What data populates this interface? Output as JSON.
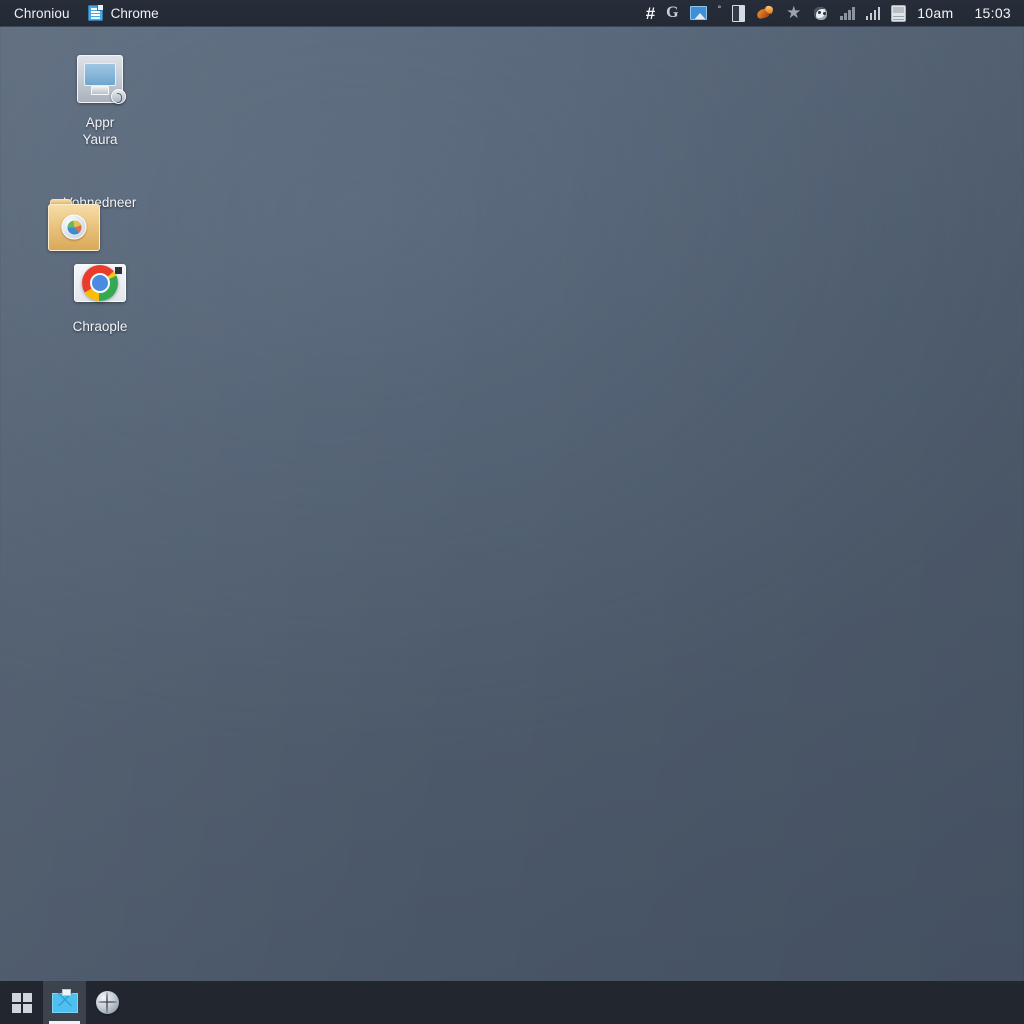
{
  "topbar": {
    "window_title": "Chroniou",
    "tab": {
      "label": "Chrome",
      "icon": "document-icon"
    },
    "tray": {
      "icons": [
        {
          "name": "hash-icon",
          "glyph": "#"
        },
        {
          "name": "google-g-icon",
          "glyph": "G"
        },
        {
          "name": "photo-icon",
          "glyph": ""
        },
        {
          "name": "degree-icon",
          "glyph": "°"
        },
        {
          "name": "book-icon",
          "glyph": ""
        },
        {
          "name": "bird-icon",
          "glyph": ""
        },
        {
          "name": "star-icon",
          "glyph": "★"
        },
        {
          "name": "blob-face-icon",
          "glyph": ""
        },
        {
          "name": "signal-weak-icon",
          "glyph": ""
        },
        {
          "name": "signal-full-icon",
          "glyph": ""
        },
        {
          "name": "battery-icon",
          "glyph": ""
        }
      ],
      "period": "10am",
      "time": "15:03"
    }
  },
  "desktop": {
    "icons": [
      {
        "name": "desktop-icon-appr-yaura",
        "label": "Appr\nYaura",
        "glyph": "display-icon"
      },
      {
        "name": "desktop-icon-vohnedneer",
        "label": "Vohnedneer",
        "glyph": "folder-icon"
      },
      {
        "name": "desktop-icon-chraople",
        "label": "Chraople",
        "glyph": "chrome-icon"
      }
    ],
    "background_color": "#4f5d6f"
  },
  "taskbar": {
    "background_color": "#22272f",
    "buttons": [
      {
        "name": "start-button",
        "icon": "grid-icon",
        "active": false
      },
      {
        "name": "taskbar-item-mail",
        "icon": "mail-icon",
        "active": true
      },
      {
        "name": "taskbar-item-browser",
        "icon": "globe-icon",
        "active": false
      }
    ]
  }
}
